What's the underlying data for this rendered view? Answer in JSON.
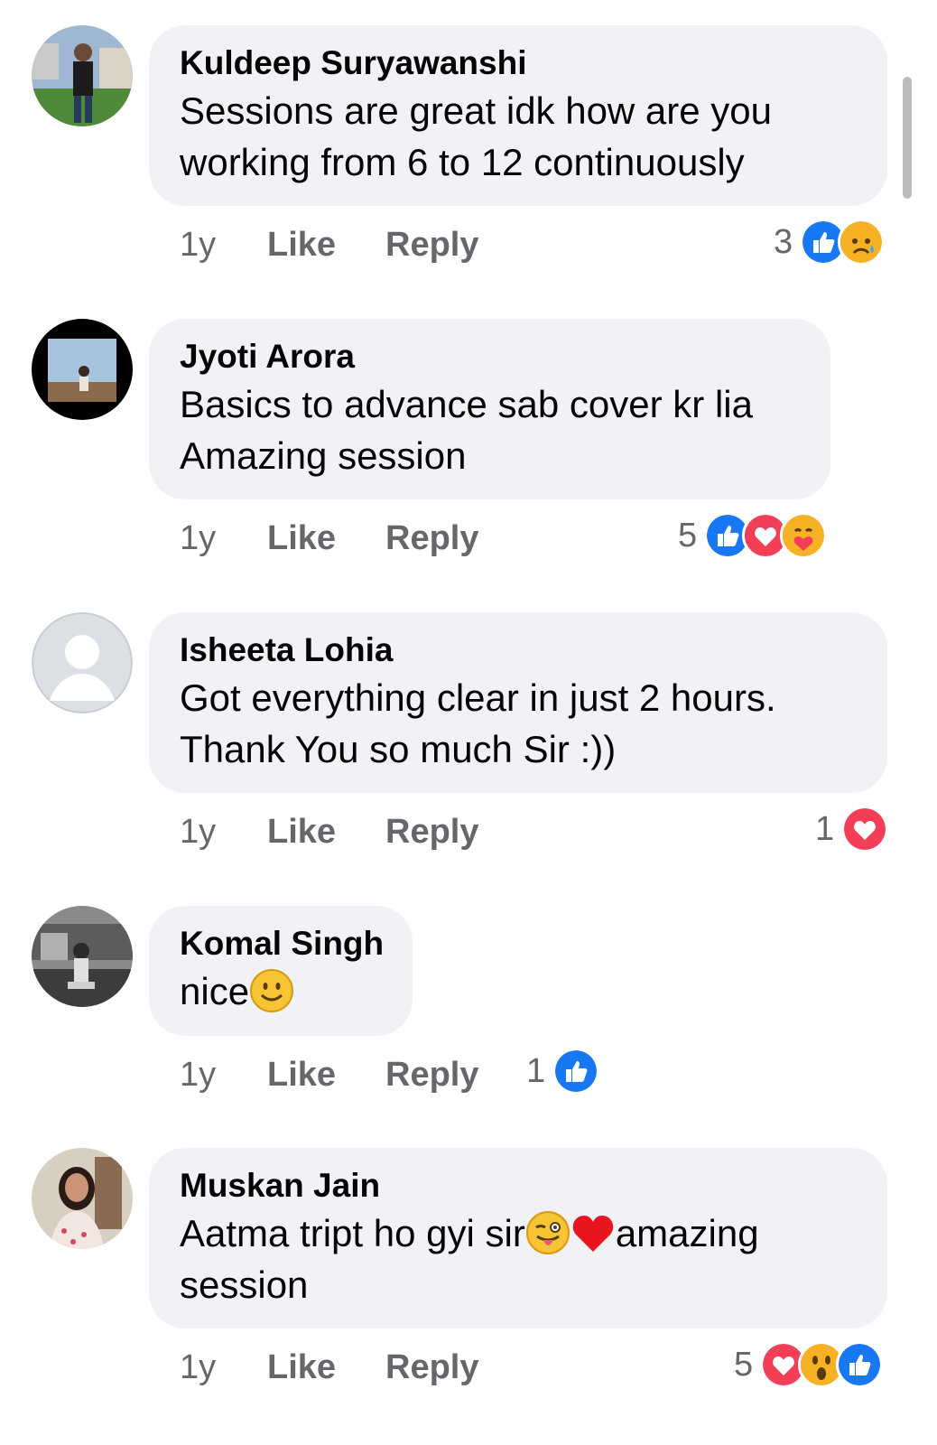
{
  "comments": [
    {
      "author": "Kuldeep Suryawanshi",
      "text": "Sessions are great idk how are you\nworking from 6 to 12 continuously",
      "time": "1y",
      "like_label": "Like",
      "reply_label": "Reply",
      "reaction_count": "3",
      "reactions": [
        "like",
        "sad"
      ]
    },
    {
      "author": "Jyoti Arora",
      "text": "Basics to advance sab cover kr lia\nAmazing session",
      "time": "1y",
      "like_label": "Like",
      "reply_label": "Reply",
      "reaction_count": "5",
      "reactions": [
        "like",
        "love",
        "care"
      ]
    },
    {
      "author": "Isheeta Lohia",
      "text": "Got everything clear in just 2 hours.\nThank You so much Sir :))",
      "time": "1y",
      "like_label": "Like",
      "reply_label": "Reply",
      "reaction_count": "1",
      "reactions": [
        "love"
      ]
    },
    {
      "author": "Komal Singh",
      "text_part1": "nice",
      "time": "1y",
      "like_label": "Like",
      "reply_label": "Reply",
      "reaction_count": "1",
      "reactions": [
        "like"
      ]
    },
    {
      "author": "Muskan Jain",
      "text_part1": "Aatma tript ho gyi sir",
      "text_part2": "amazing",
      "text_part3": "session",
      "time": "1y",
      "like_label": "Like",
      "reply_label": "Reply",
      "reaction_count": "5",
      "reactions": [
        "love",
        "wow",
        "like"
      ]
    }
  ],
  "colors": {
    "bubble": "#f0f2f5",
    "meta_text": "#65676b",
    "like_blue": "#1877f2",
    "love_red": "#f33e58",
    "emoji_yellow": "#f7b125"
  }
}
